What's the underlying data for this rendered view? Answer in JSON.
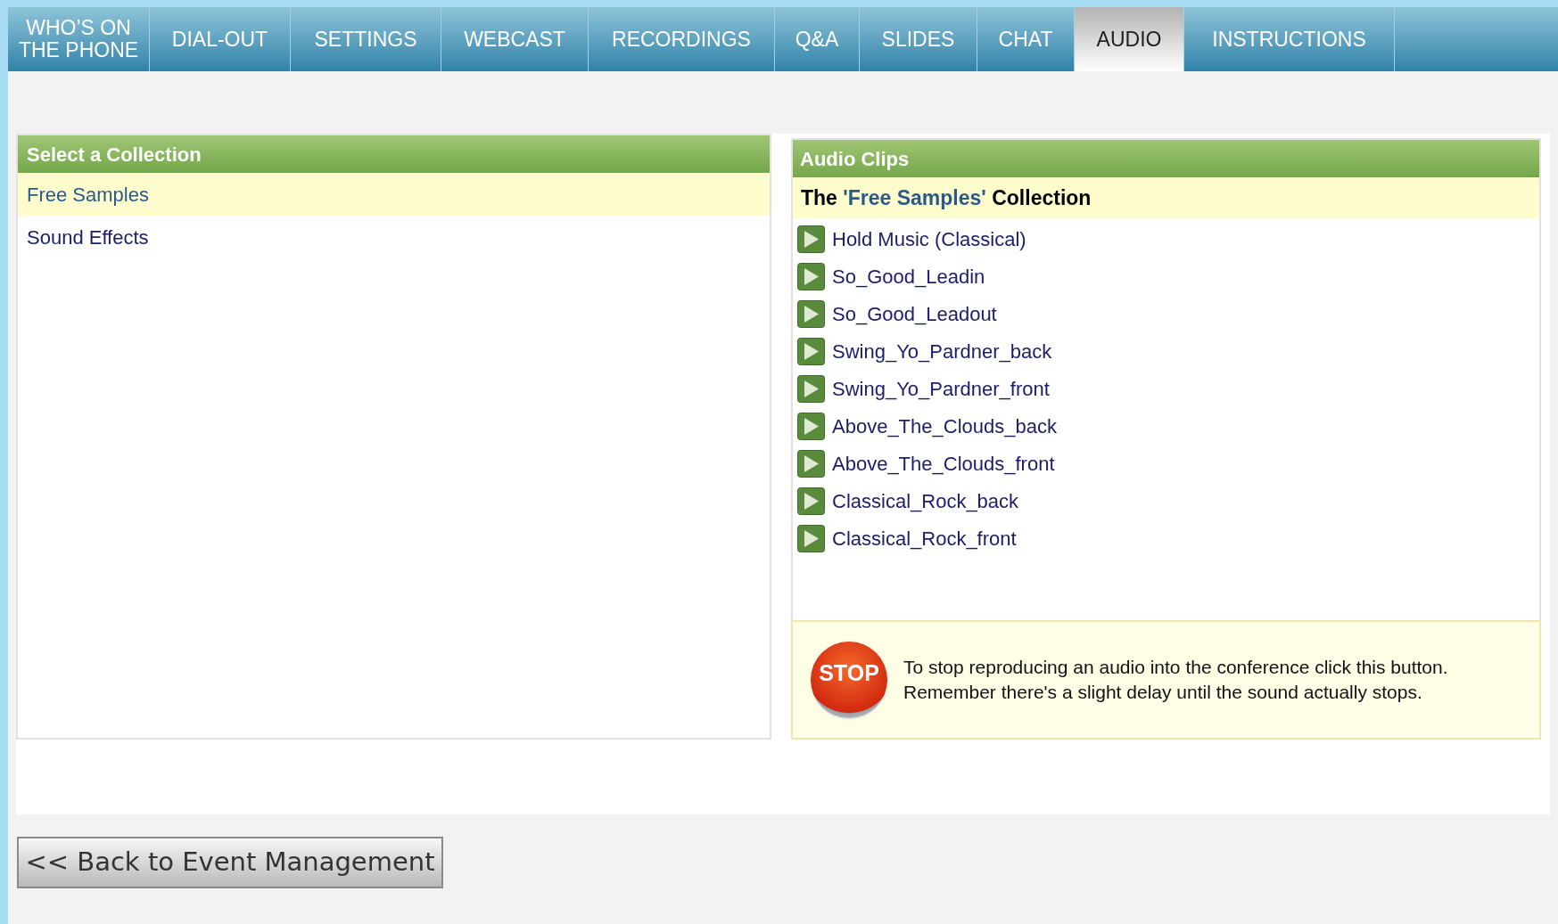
{
  "tabs": [
    {
      "label": "WHO’S ON THE PHONE",
      "selected": false
    },
    {
      "label": "DIAL-OUT",
      "selected": false
    },
    {
      "label": "SETTINGS",
      "selected": false
    },
    {
      "label": "WEBCAST",
      "selected": false
    },
    {
      "label": "RECORDINGS",
      "selected": false
    },
    {
      "label": "Q&A",
      "selected": false
    },
    {
      "label": "SLIDES",
      "selected": false
    },
    {
      "label": "CHAT",
      "selected": false
    },
    {
      "label": "AUDIO",
      "selected": true
    },
    {
      "label": "INSTRUCTIONS",
      "selected": false
    }
  ],
  "collections": {
    "title": "Select a Collection",
    "items": [
      {
        "label": "Free Samples",
        "selected": true
      },
      {
        "label": "Sound Effects",
        "selected": false
      }
    ]
  },
  "audio_clips": {
    "title": "Audio Clips",
    "collection_heading_before": "The",
    "collection_name": "'Free Samples'",
    "collection_heading_after": "Collection",
    "clips": [
      "Hold Music (Classical)",
      "So_Good_Leadin",
      "So_Good_Leadout",
      "Swing_Yo_Pardner_back",
      "Swing_Yo_Pardner_front",
      "Above_The_Clouds_back",
      "Above_The_Clouds_front",
      "Classical_Rock_back",
      "Classical_Rock_front"
    ],
    "stop": {
      "button": "STOP",
      "message": "To stop reproducing an audio into the conference click this button. Remember there's a slight delay until the sound actually stops."
    }
  },
  "back_button": "<< Back to Event Management"
}
